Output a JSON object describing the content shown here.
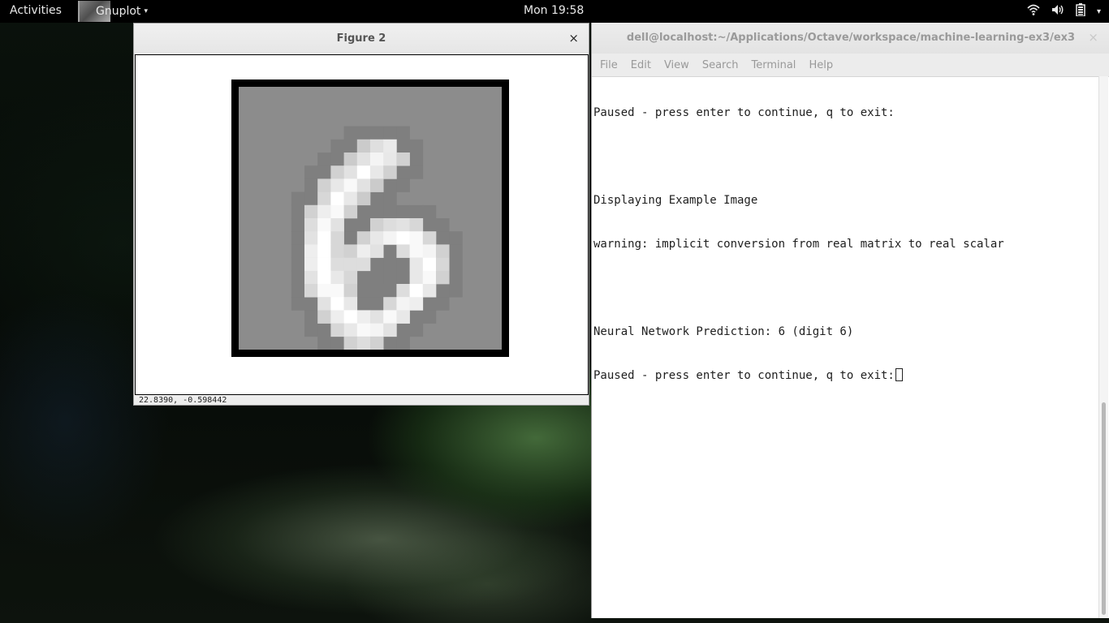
{
  "topbar": {
    "activities": "Activities",
    "app_name": "Gnuplot",
    "app_arrow": "▾",
    "clock": "Mon 19:58",
    "tray_menu_arrow": "▾"
  },
  "figure": {
    "title": "Figure 2",
    "close": "×",
    "status_coords": "22.8390, -0.598442",
    "pixel_background": "#8c8c8c",
    "digit_pixels": [
      [
        9,
        4,
        0.55
      ],
      [
        10,
        4,
        0.72
      ],
      [
        11,
        4,
        0.82
      ],
      [
        8,
        5,
        0.55
      ],
      [
        9,
        5,
        0.75
      ],
      [
        10,
        5,
        0.9
      ],
      [
        11,
        5,
        0.8
      ],
      [
        12,
        5,
        0.6
      ],
      [
        7,
        6,
        0.6
      ],
      [
        8,
        6,
        0.75
      ],
      [
        9,
        6,
        1.0
      ],
      [
        10,
        6,
        0.8
      ],
      [
        11,
        6,
        0.6
      ],
      [
        6,
        7,
        0.6
      ],
      [
        7,
        7,
        0.8
      ],
      [
        8,
        7,
        0.95
      ],
      [
        9,
        7,
        0.75
      ],
      [
        10,
        7,
        0.55
      ],
      [
        6,
        8,
        0.65
      ],
      [
        7,
        8,
        1.0
      ],
      [
        8,
        8,
        0.8
      ],
      [
        9,
        8,
        0.55
      ],
      [
        5,
        9,
        0.6
      ],
      [
        6,
        9,
        0.85
      ],
      [
        7,
        9,
        0.95
      ],
      [
        8,
        9,
        0.6
      ],
      [
        5,
        10,
        0.7
      ],
      [
        6,
        10,
        0.95
      ],
      [
        7,
        10,
        0.75
      ],
      [
        10,
        10,
        0.6
      ],
      [
        11,
        10,
        0.7
      ],
      [
        12,
        10,
        0.75
      ],
      [
        13,
        10,
        0.65
      ],
      [
        5,
        11,
        0.75
      ],
      [
        6,
        11,
        1.0
      ],
      [
        7,
        11,
        0.65
      ],
      [
        9,
        11,
        0.6
      ],
      [
        10,
        11,
        0.8
      ],
      [
        11,
        11,
        0.9
      ],
      [
        12,
        11,
        1.0
      ],
      [
        13,
        11,
        0.95
      ],
      [
        14,
        11,
        0.65
      ],
      [
        5,
        12,
        0.85
      ],
      [
        6,
        12,
        1.0
      ],
      [
        7,
        12,
        0.65
      ],
      [
        8,
        12,
        0.6
      ],
      [
        9,
        12,
        0.85
      ],
      [
        10,
        12,
        0.75
      ],
      [
        12,
        12,
        0.7
      ],
      [
        13,
        12,
        0.95
      ],
      [
        14,
        12,
        0.9
      ],
      [
        15,
        12,
        0.6
      ],
      [
        5,
        13,
        0.85
      ],
      [
        6,
        13,
        1.0
      ],
      [
        7,
        13,
        0.7
      ],
      [
        8,
        13,
        0.7
      ],
      [
        9,
        13,
        0.7
      ],
      [
        13,
        13,
        0.8
      ],
      [
        14,
        13,
        1.0
      ],
      [
        15,
        13,
        0.65
      ],
      [
        5,
        14,
        0.75
      ],
      [
        6,
        14,
        1.0
      ],
      [
        7,
        14,
        0.8
      ],
      [
        8,
        14,
        0.65
      ],
      [
        13,
        14,
        0.8
      ],
      [
        14,
        14,
        0.95
      ],
      [
        15,
        14,
        0.6
      ],
      [
        5,
        15,
        0.65
      ],
      [
        6,
        15,
        0.95
      ],
      [
        7,
        15,
        0.95
      ],
      [
        8,
        15,
        0.6
      ],
      [
        12,
        15,
        0.7
      ],
      [
        13,
        15,
        1.0
      ],
      [
        14,
        15,
        0.8
      ],
      [
        6,
        16,
        0.75
      ],
      [
        7,
        16,
        1.0
      ],
      [
        8,
        16,
        0.8
      ],
      [
        11,
        16,
        0.65
      ],
      [
        12,
        16,
        0.9
      ],
      [
        13,
        16,
        0.85
      ],
      [
        6,
        17,
        0.6
      ],
      [
        7,
        17,
        0.85
      ],
      [
        8,
        17,
        1.0
      ],
      [
        9,
        17,
        0.85
      ],
      [
        10,
        17,
        0.75
      ],
      [
        11,
        17,
        0.95
      ],
      [
        12,
        17,
        0.8
      ],
      [
        7,
        18,
        0.65
      ],
      [
        8,
        18,
        0.8
      ],
      [
        9,
        18,
        0.95
      ],
      [
        10,
        18,
        0.9
      ],
      [
        11,
        18,
        0.75
      ],
      [
        8,
        19,
        0.6
      ],
      [
        9,
        19,
        0.7
      ],
      [
        10,
        19,
        0.6
      ]
    ]
  },
  "terminal": {
    "title": "dell@localhost:~/Applications/Octave/workspace/machine-learning-ex3/ex3",
    "close": "×",
    "menu": [
      "File",
      "Edit",
      "View",
      "Search",
      "Terminal",
      "Help"
    ],
    "lines": [
      "Paused - press enter to continue, q to exit:",
      "",
      "Displaying Example Image",
      "warning: implicit conversion from real matrix to real scalar",
      "",
      "Neural Network Prediction: 6 (digit 6)",
      "Paused - press enter to continue, q to exit:"
    ]
  }
}
